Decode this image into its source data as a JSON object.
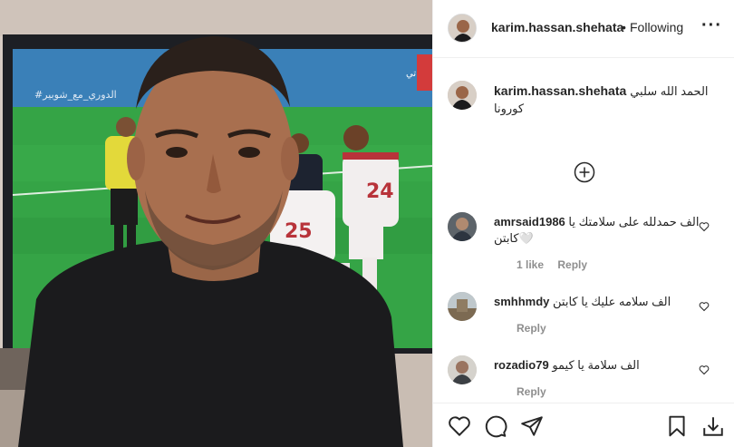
{
  "post": {
    "author": "karim.hassan.shehata",
    "follow_status": "Following",
    "more_icon": "more-options-icon",
    "caption_line1": "الحمد الله سلبي",
    "caption_line2": "كورونا",
    "tv_text_left": "#الدوري_مع_شوبير",
    "tv_text_right": "بحياتي",
    "jersey_numbers": [
      "25",
      "24"
    ]
  },
  "comments": [
    {
      "username": "amrsaid1986",
      "text_line1": "الف حمدلله على سلامتك يا",
      "text_line2": "كابتن🤍",
      "likes": "1 like",
      "reply": "Reply"
    },
    {
      "username": "smhhmdy",
      "text_line1": "الف سلامه عليك يا كابتن",
      "reply": "Reply"
    },
    {
      "username": "rozadio79",
      "text_line1": "الف سلامة يا كيمو",
      "reply": "Reply"
    }
  ],
  "icons": {
    "like": "heart-icon",
    "comment": "comment-icon",
    "share": "share-icon",
    "save": "bookmark-icon",
    "load_more": "plus-circle-icon"
  }
}
